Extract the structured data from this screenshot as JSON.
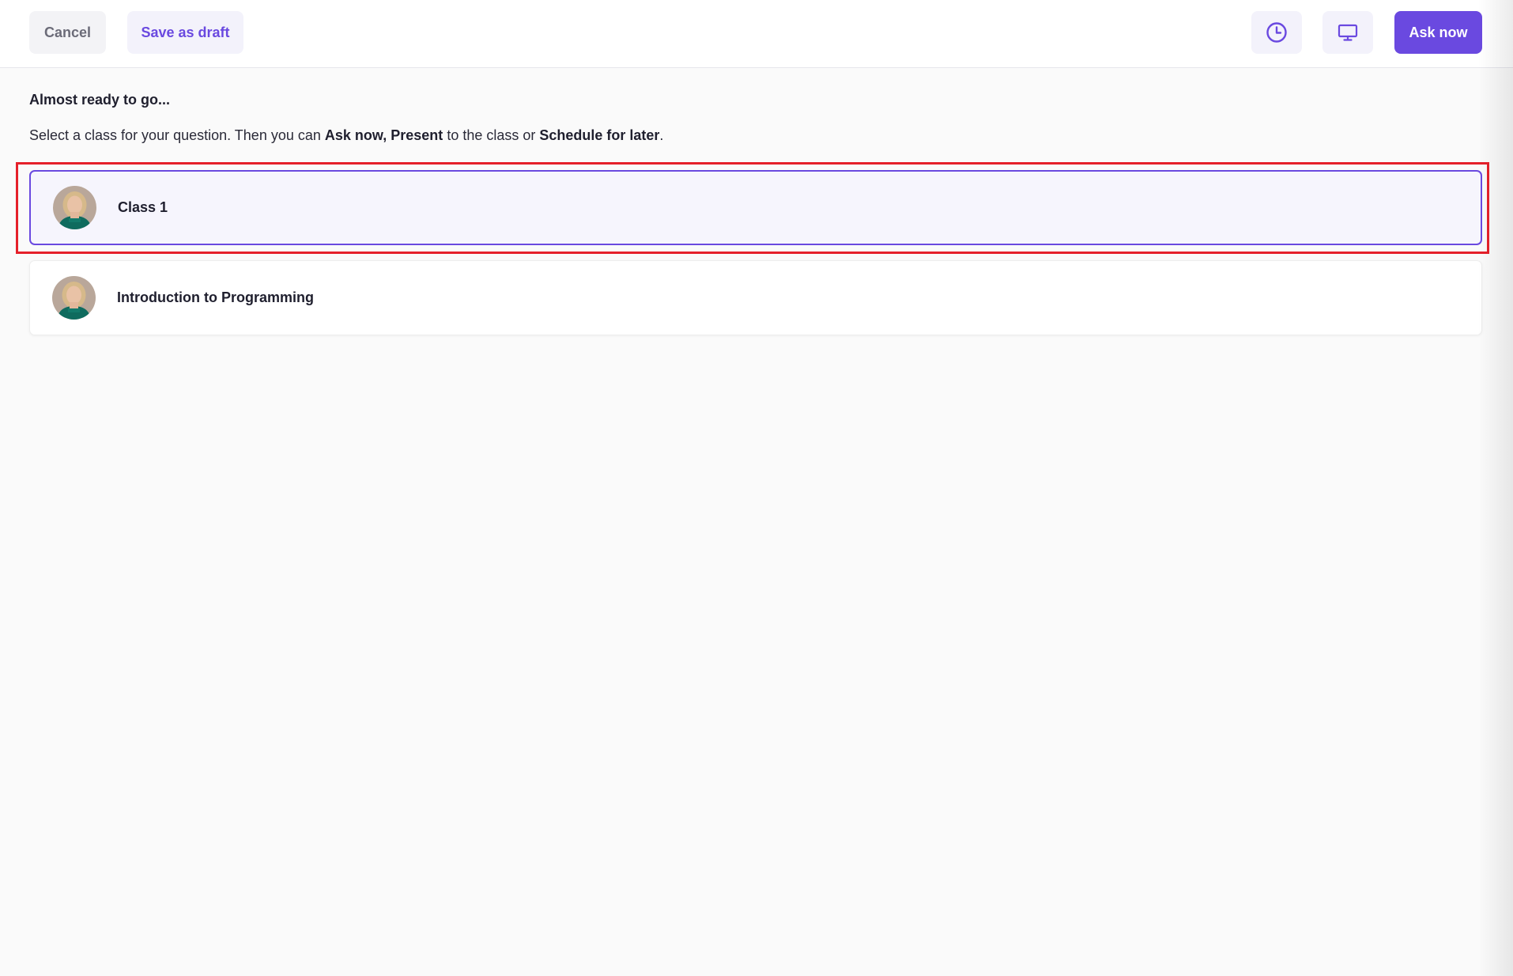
{
  "toolbar": {
    "cancel_label": "Cancel",
    "save_draft_label": "Save as draft",
    "schedule_icon": "clock-icon",
    "present_icon": "monitor-icon",
    "ask_now_label": "Ask now"
  },
  "main": {
    "heading": "Almost ready to go...",
    "instruction": {
      "part1": "Select a class for your question. Then you can ",
      "ask_now": "Ask now",
      "part2": ", ",
      "present": "Present",
      "part3": " to the class or ",
      "schedule": "Schedule for later",
      "part4": "."
    },
    "classes": [
      {
        "name": "Class 1",
        "selected": true
      },
      {
        "name": "Introduction to Programming",
        "selected": false
      }
    ]
  },
  "colors": {
    "accent": "#6a49e0",
    "highlight_border": "#e5202a",
    "background": "#fafafa"
  }
}
